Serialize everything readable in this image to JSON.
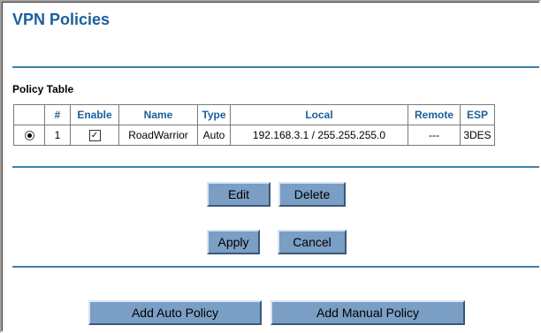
{
  "page": {
    "title": "VPN Policies"
  },
  "policy_table": {
    "label": "Policy Table",
    "columns": [
      "",
      "#",
      "Enable",
      "Name",
      "Type",
      "Local",
      "Remote",
      "ESP"
    ],
    "rows": [
      {
        "selected": true,
        "number": "1",
        "enabled": true,
        "name": "RoadWarrior",
        "type": "Auto",
        "local": "192.168.3.1 / 255.255.255.0",
        "remote": "---",
        "esp": "3DES"
      }
    ]
  },
  "actions": {
    "edit": "Edit",
    "delete": "Delete",
    "apply": "Apply",
    "cancel": "Cancel",
    "add_auto": "Add Auto Policy",
    "add_manual": "Add Manual Policy"
  },
  "colors": {
    "accent": "#1a5f9c",
    "button": "#7a9ec4",
    "rule": "#3e7fb0"
  },
  "icons": {
    "radio": "radio-selected-icon",
    "checkbox": "checkbox-checked-icon"
  }
}
